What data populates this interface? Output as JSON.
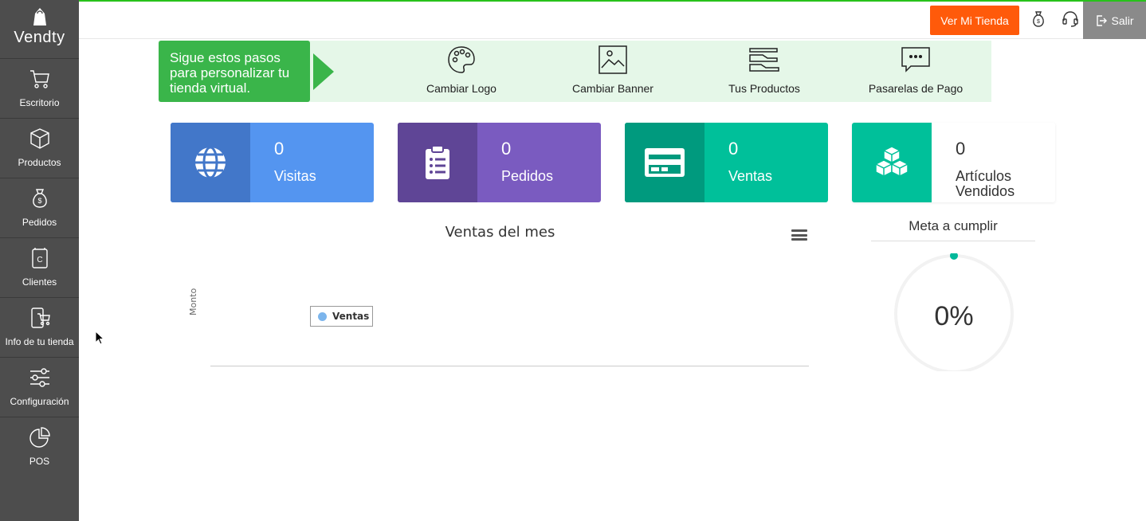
{
  "sidebar": {
    "logo": "Vendty",
    "items": [
      {
        "label": "Escritorio"
      },
      {
        "label": "Productos"
      },
      {
        "label": "Pedidos"
      },
      {
        "label": "Clientes"
      },
      {
        "label": "Info de tu tienda"
      },
      {
        "label": "Configuración"
      },
      {
        "label": "POS"
      }
    ]
  },
  "topbar": {
    "store_button": "Ver Mi Tienda",
    "exit_label": "Salir",
    "accent_color": "#ff5a0a"
  },
  "steps": {
    "message": "Sigue estos pasos para personalizar tu tienda virtual.",
    "items": [
      {
        "label": "Cambiar Logo",
        "icon": "palette-icon"
      },
      {
        "label": "Cambiar Banner",
        "icon": "image-icon"
      },
      {
        "label": "Tus Productos",
        "icon": "shoes-icon"
      },
      {
        "label": "Pasarelas de Pago",
        "icon": "chat-dots-icon"
      }
    ]
  },
  "stats": [
    {
      "value": "0",
      "label": "Visitas",
      "icon": "globe-icon",
      "color": "#5495f0",
      "icon_bg": "#4277c9"
    },
    {
      "value": "0",
      "label": "Pedidos",
      "icon": "clipboard-icon",
      "color": "#7a5bc0",
      "icon_bg": "#5f4596"
    },
    {
      "value": "0",
      "label": "Ventas",
      "icon": "credit-card-icon",
      "color": "#00c09a",
      "icon_bg": "#009a7e"
    },
    {
      "value": "0",
      "label": "Artículos Vendidos",
      "icon": "boxes-icon",
      "color": "#ffffff",
      "icon_bg": "#00c09a"
    }
  ],
  "chart": {
    "title": "Ventas del mes",
    "ylabel": "Monto",
    "legend": "Ventas"
  },
  "chart_data": {
    "type": "line",
    "title": "Ventas del mes",
    "xlabel": "",
    "ylabel": "Monto",
    "series": [
      {
        "name": "Ventas",
        "values": []
      }
    ],
    "legend": "top-left"
  },
  "goal": {
    "title": "Meta a cumplir",
    "value": "0%",
    "progress": 0
  }
}
